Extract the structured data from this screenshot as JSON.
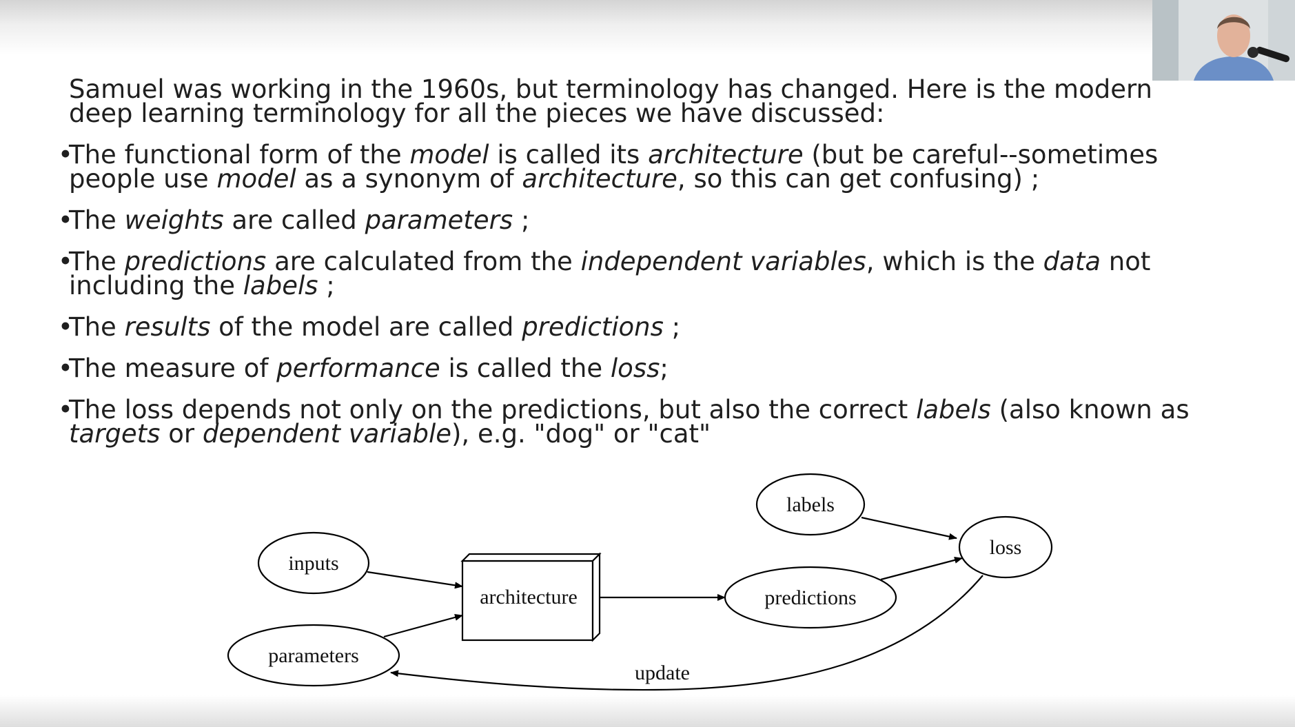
{
  "slide": {
    "intro": "Samuel was working in the 1960s, but terminology has changed. Here is the modern deep learning terminology for all the pieces we have discussed:",
    "bullets": [
      [
        {
          "t": "The functional form of the "
        },
        {
          "t": "model",
          "i": true
        },
        {
          "t": " is called its "
        },
        {
          "t": "architecture",
          "i": true
        },
        {
          "t": " (but be careful--sometimes people use "
        },
        {
          "t": "model",
          "i": true
        },
        {
          "t": " as a synonym of "
        },
        {
          "t": "architecture",
          "i": true
        },
        {
          "t": ", so this can get confusing) ;"
        }
      ],
      [
        {
          "t": "The "
        },
        {
          "t": "weights",
          "i": true
        },
        {
          "t": " are called "
        },
        {
          "t": "parameters",
          "i": true
        },
        {
          "t": " ;"
        }
      ],
      [
        {
          "t": "The "
        },
        {
          "t": "predictions",
          "i": true
        },
        {
          "t": " are calculated from the "
        },
        {
          "t": "independent variables",
          "i": true
        },
        {
          "t": ", which is the "
        },
        {
          "t": "data",
          "i": true
        },
        {
          "t": " not including the "
        },
        {
          "t": "labels",
          "i": true
        },
        {
          "t": " ;"
        }
      ],
      [
        {
          "t": "The "
        },
        {
          "t": "results",
          "i": true
        },
        {
          "t": " of the model are called "
        },
        {
          "t": "predictions",
          "i": true
        },
        {
          "t": " ;"
        }
      ],
      [
        {
          "t": "The measure of "
        },
        {
          "t": "performance",
          "i": true
        },
        {
          "t": " is called the "
        },
        {
          "t": "loss",
          "i": true
        },
        {
          "t": ";"
        }
      ],
      [
        {
          "t": "The loss depends not only on the predictions, but also the correct "
        },
        {
          "t": "labels",
          "i": true
        },
        {
          "t": " (also known as "
        },
        {
          "t": "targets",
          "i": true
        },
        {
          "t": " or "
        },
        {
          "t": "dependent variable",
          "i": true
        },
        {
          "t": "), e.g. \"dog\" or \"cat\""
        }
      ]
    ]
  },
  "diagram": {
    "nodes": {
      "inputs": "inputs",
      "parameters": "parameters",
      "architecture": "architecture",
      "predictions": "predictions",
      "labels": "labels",
      "loss": "loss"
    },
    "edge_labels": {
      "update": "update"
    }
  },
  "webcam": {
    "icon": "presenter-webcam-feed"
  }
}
